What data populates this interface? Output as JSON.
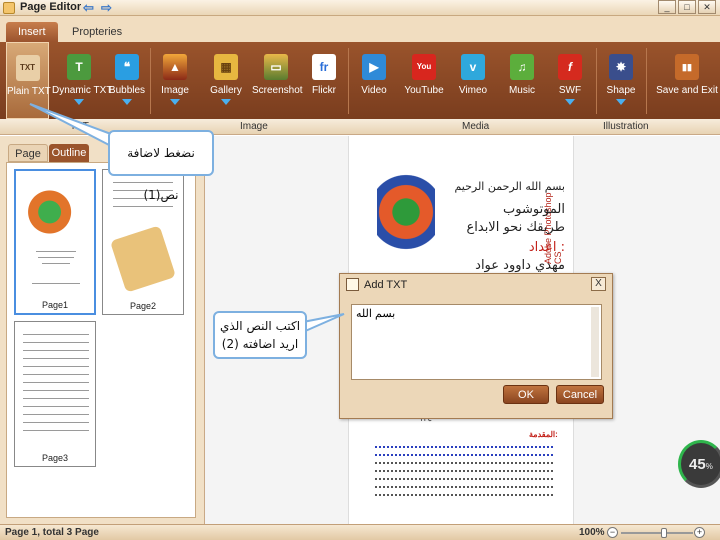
{
  "window": {
    "title": "Page Editor",
    "back_arrow": "⇦",
    "forward_arrow": "⇨",
    "minimize": "_",
    "maximize": "□",
    "close": "✕"
  },
  "ribbon_tabs": [
    "Insert",
    "Propteries"
  ],
  "ribbon_buttons": [
    {
      "label": "Plain TXT",
      "icon": "plain-txt-icon",
      "glyph": "TXT"
    },
    {
      "label": "Dynamic TXT",
      "icon": "dynamic-txt-icon",
      "glyph": "T"
    },
    {
      "label": "Bubbles",
      "icon": "bubbles-icon",
      "glyph": "❝"
    },
    {
      "label": "Image",
      "icon": "image-icon",
      "glyph": "▲"
    },
    {
      "label": "Gallery",
      "icon": "gallery-icon",
      "glyph": "▦"
    },
    {
      "label": "Screenshot",
      "icon": "screenshot-icon",
      "glyph": "▭"
    },
    {
      "label": "Flickr",
      "icon": "flickr-icon",
      "glyph": "fr"
    },
    {
      "label": "Video",
      "icon": "video-icon",
      "glyph": "▶"
    },
    {
      "label": "YouTube",
      "icon": "youtube-icon",
      "glyph": "You"
    },
    {
      "label": "Vimeo",
      "icon": "vimeo-icon",
      "glyph": "v"
    },
    {
      "label": "Music",
      "icon": "music-icon",
      "glyph": "♫"
    },
    {
      "label": "SWF",
      "icon": "swf-icon",
      "glyph": "f"
    },
    {
      "label": "Shape",
      "icon": "shape-icon",
      "glyph": "✸"
    },
    {
      "label": "Save and Exit",
      "icon": "save-exit-icon",
      "glyph": "▮▮"
    }
  ],
  "ribbon_groups": [
    "TXT",
    "Image",
    "Media",
    "Illustration"
  ],
  "panel": {
    "tabs": [
      "Page",
      "Outline"
    ],
    "pages": [
      "Page1",
      "Page2",
      "Page3"
    ]
  },
  "document": {
    "cover_lines": [
      "بسم الله الرحمن الرحيم",
      "الموتوشوب",
      "طريقك نحو الابداع",
      "اعداد :",
      "مهدي داوود عواد"
    ],
    "vertical_logo": "Adobe Photoshop CS",
    "page_number": "١٢٤",
    "heading": "المقدمة:"
  },
  "dialog": {
    "title": "Add TXT",
    "close": "X",
    "text_value": "بسم الله",
    "ok_label": "OK",
    "cancel_label": "Cancel"
  },
  "callouts": {
    "first": "نضغط لاضافة نص(1)",
    "second_line1": "اكتب النص الذي",
    "second_line2": "اريد اضافته (2)"
  },
  "status": {
    "text": "Page 1, total 3 Page",
    "zoom": "100%",
    "zoom_fraction": 0.6,
    "minus": "−",
    "plus": "+"
  },
  "overlay_badge": {
    "value": "45",
    "unit": "%"
  },
  "colors": {
    "accent_brown": "#9a542c",
    "selection_blue": "#4a8ee0",
    "callout_border": "#7db0e0"
  }
}
